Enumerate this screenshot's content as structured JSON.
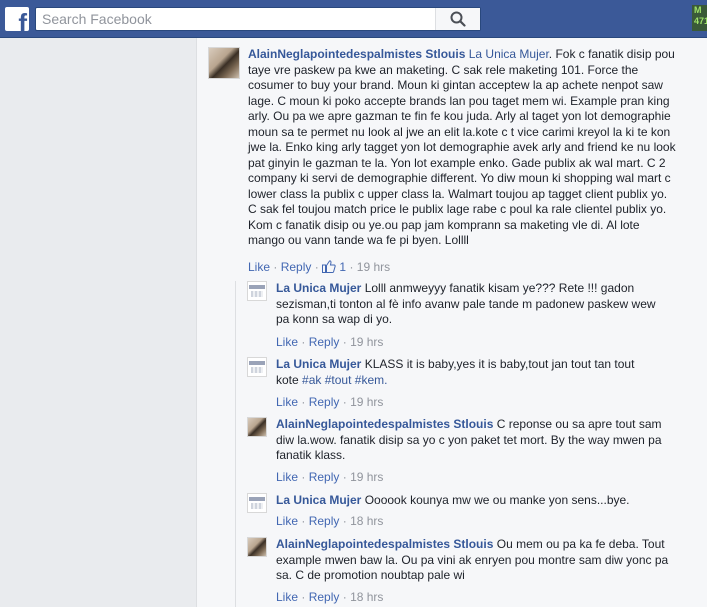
{
  "header": {
    "logo": "f",
    "search_placeholder": "Search Facebook",
    "search_icon": "magnifier-icon",
    "corner_badge_text": "M 471"
  },
  "main_comment": {
    "author": "AlainNeglapointedespalmistes Stlouis",
    "mention": "La Unica Mujer",
    "text": ". Fok c fanatik disip pou taye vre paskew pa kwe an maketing. C sak rele maketing 101. Force the cosumer to buy your brand. Moun ki gintan acceptew la ap achete nenpot saw lage. C moun ki poko accepte brands lan pou taget mem wi. Example pran king arly. Ou pa we apre gazman te fin fe kou juda. Arly al taget yon lot demographie moun sa te permet nu look al jwe an elit la.kote c t vice carimi kreyol la ki te kon jwe la. Enko king arly tagget yon lot demographie avek arly and friend ke nu look pat ginyin le gazman te la. Yon lot example enko. Gade publix ak wal mart. C 2 company ki servi de demographie different. Yo diw moun ki shopping wal mart c lower class la publix c upper class la. Walmart toujou ap tagget client publix yo. C sak fel toujou match price le publix lage rabe c poul ka rale clientel publix yo. Kom c fanatik disip ou ye.ou pap jam komprann sa maketing vle di. Al lote mango ou vann tande wa fe pi byen. Lollll",
    "like_label": "Like",
    "reply_label": "Reply",
    "like_count": "1",
    "time": "19 hrs"
  },
  "replies": [
    {
      "author": "La Unica Mujer",
      "text": "Lolll anmweyyy fanatik kisam ye??? Rete !!! gadon sezisman,ti tonton al fè info avanw pale tande m padonew paskew wew pa konn sa wap di yo.",
      "like_label": "Like",
      "reply_label": "Reply",
      "time": "19 hrs"
    },
    {
      "author": "La Unica Mujer",
      "text": "KLASS it is baby,yes it is baby,tout jan tout tan tout kote",
      "hashtags": [
        "#ak",
        "#tout",
        "#kem."
      ],
      "like_label": "Like",
      "reply_label": "Reply",
      "time": "19 hrs"
    },
    {
      "author": "AlainNeglapointedespalmistes Stlouis",
      "text": "C reponse ou sa apre tout sam diw la.wow. fanatik disip sa yo c yon paket tet mort. By the way mwen pa fanatik klass.",
      "like_label": "Like",
      "reply_label": "Reply",
      "time": "19 hrs"
    },
    {
      "author": "La Unica Mujer",
      "text": "Oooook kounya mw we ou manke yon sens...bye.",
      "like_label": "Like",
      "reply_label": "Reply",
      "time": "18 hrs"
    },
    {
      "author": "AlainNeglapointedespalmistes Stlouis",
      "text": "Ou mem ou pa ka fe deba. Tout example mwen baw la. Ou pa vini ak enryen pou montre sam diw yonc pa sa. C de promotion noubtap pale wi",
      "like_label": "Like",
      "reply_label": "Reply",
      "time": "18 hrs"
    }
  ]
}
